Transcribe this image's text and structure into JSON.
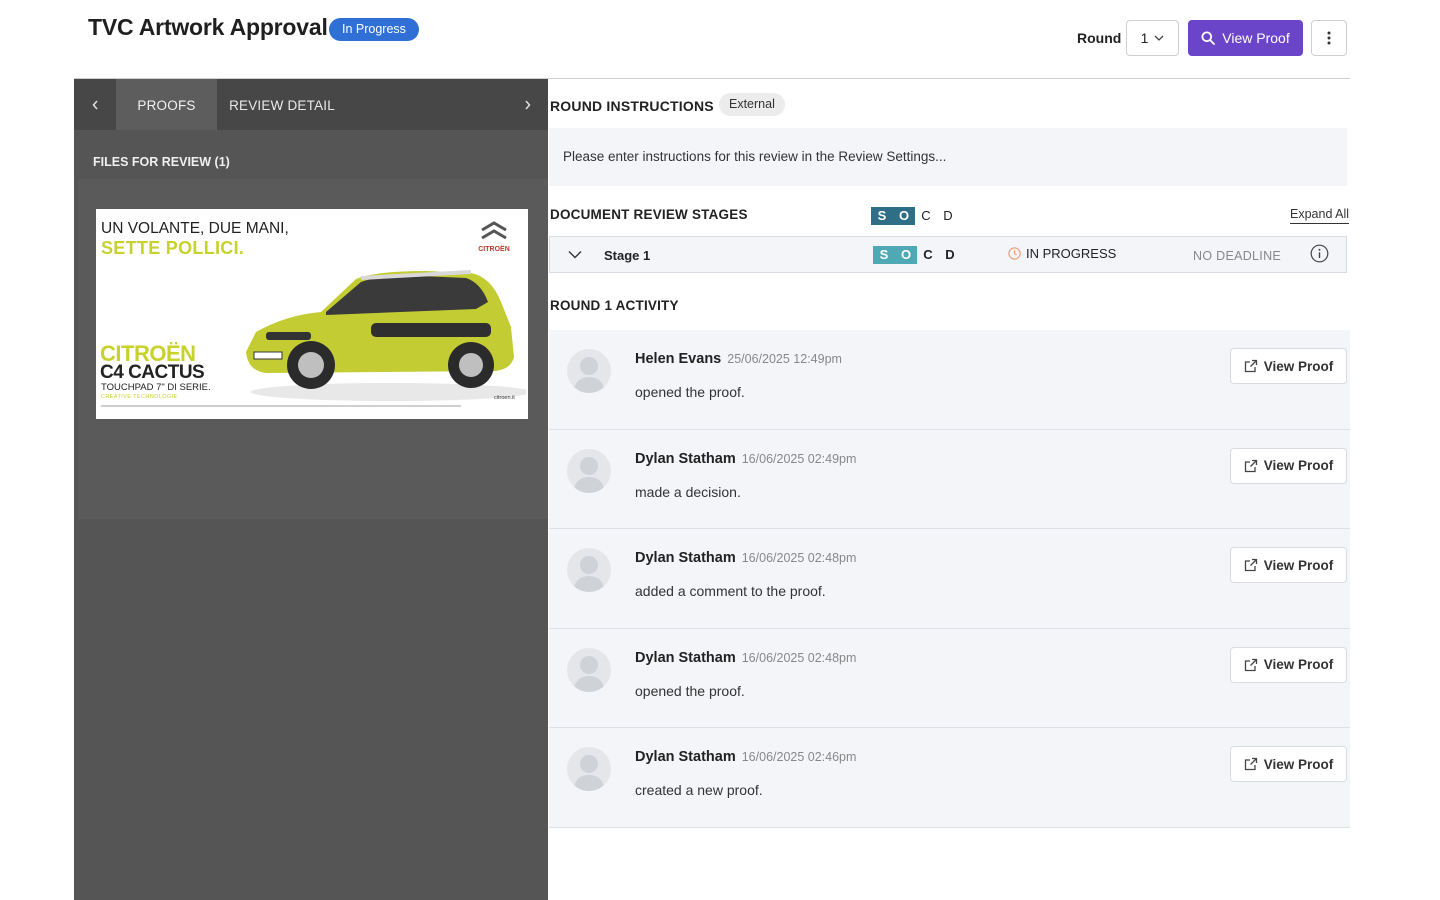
{
  "header": {
    "title": "TVC Artwork Approval",
    "status": "In Progress",
    "round_label": "Round",
    "round_value": "1",
    "view_proof_label": "View Proof",
    "colors": {
      "primary": "#6a45c9",
      "status": "#2f6fd6"
    }
  },
  "left_panel": {
    "tabs": [
      {
        "label": "PROOFS",
        "active": true
      },
      {
        "label": "REVIEW DETAIL",
        "active": false
      }
    ],
    "files_label": "FILES FOR REVIEW (1)",
    "thumbnail": {
      "headline_1": "UN VOLANTE, DUE MANI,",
      "headline_2": "SETTE POLLICI.",
      "brand_logo": "CITROËN",
      "brand": "CITROËN",
      "model": "C4 CACTUS",
      "tagline": "TOUCHPAD 7\" DI SERIE.",
      "subtagline": "CRÉATIVE TECHNOLOGIE",
      "website": "citroen.it"
    }
  },
  "instructions": {
    "heading": "ROUND INSTRUCTIONS",
    "badge": "External",
    "text": "Please enter instructions for this review in the Review Settings..."
  },
  "stages": {
    "heading": "DOCUMENT REVIEW STAGES",
    "legend": [
      "S",
      "O",
      "C",
      "D"
    ],
    "expand_label": "Expand All",
    "items": [
      {
        "name": "Stage 1",
        "status": "IN PROGRESS",
        "deadline": "NO DEADLINE",
        "icons": [
          "S",
          "O",
          "C",
          "D"
        ]
      }
    ]
  },
  "activity": {
    "heading": "ROUND 1 ACTIVITY",
    "button_label": "View Proof",
    "items": [
      {
        "user": "Helen Evans",
        "time": "25/06/2025 12:49pm",
        "action": "opened the proof."
      },
      {
        "user": "Dylan Statham",
        "time": "16/06/2025 02:49pm",
        "action": "made a decision."
      },
      {
        "user": "Dylan Statham",
        "time": "16/06/2025 02:48pm",
        "action": "added a comment to the proof."
      },
      {
        "user": "Dylan Statham",
        "time": "16/06/2025 02:48pm",
        "action": "opened the proof."
      },
      {
        "user": "Dylan Statham",
        "time": "16/06/2025 02:46pm",
        "action": "created a new proof."
      }
    ]
  }
}
